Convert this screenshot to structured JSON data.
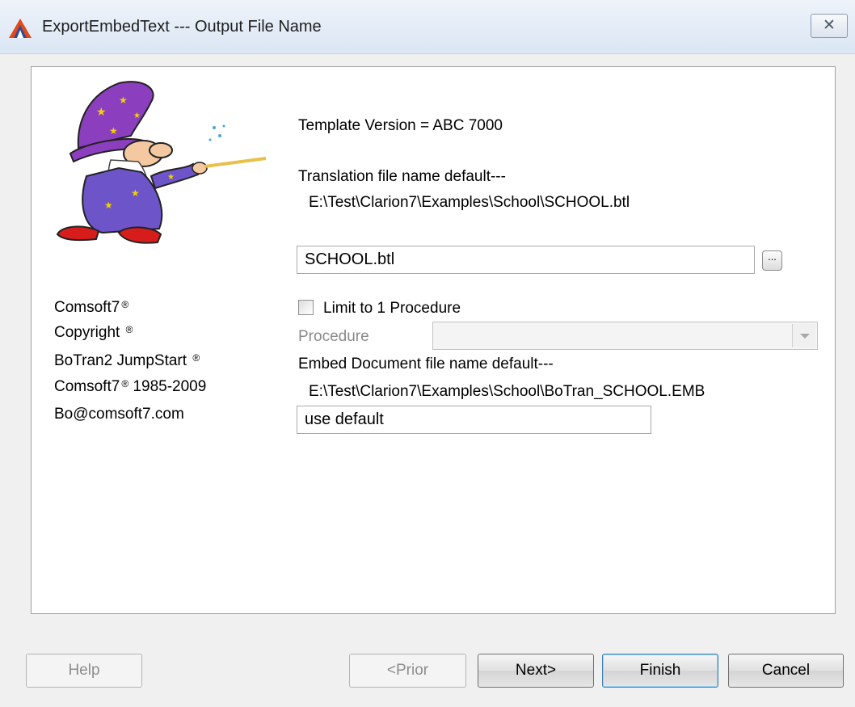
{
  "window": {
    "title": "ExportEmbedText --- Output File Name",
    "close_label": "✕"
  },
  "info": {
    "template_version": "Template Version = ABC 7000",
    "translation_default_label": "Translation file name default---",
    "translation_default_path": "E:\\Test\\Clarion7\\Examples\\School\\SCHOOL.btl",
    "embed_default_label": "Embed Document file name default---",
    "embed_default_path": "E:\\Test\\Clarion7\\Examples\\School\\BoTran_SCHOOL.EMB"
  },
  "form": {
    "translation_file_value": "SCHOOL.btl",
    "browse_label": "...",
    "limit_checkbox_label": "Limit to 1 Procedure",
    "limit_checked": false,
    "procedure_label": "Procedure",
    "procedure_value": "",
    "embed_file_value": "use default"
  },
  "credits": {
    "line1": "Comsoft7",
    "line2": "Copyright",
    "line3": "BoTran2 JumpStart",
    "line4_a": "Comsoft7",
    "line4_b": "1985-2009",
    "line5": "Bo@comsoft7.com",
    "mark": "®"
  },
  "buttons": {
    "help": "Help",
    "prior": "<Prior",
    "next": "Next>",
    "finish": "Finish",
    "cancel": "Cancel"
  },
  "colors": {
    "hat": "#8b3fbf",
    "robe": "#6d54c8",
    "shoes": "#d71c1c",
    "star": "#f2d200"
  }
}
